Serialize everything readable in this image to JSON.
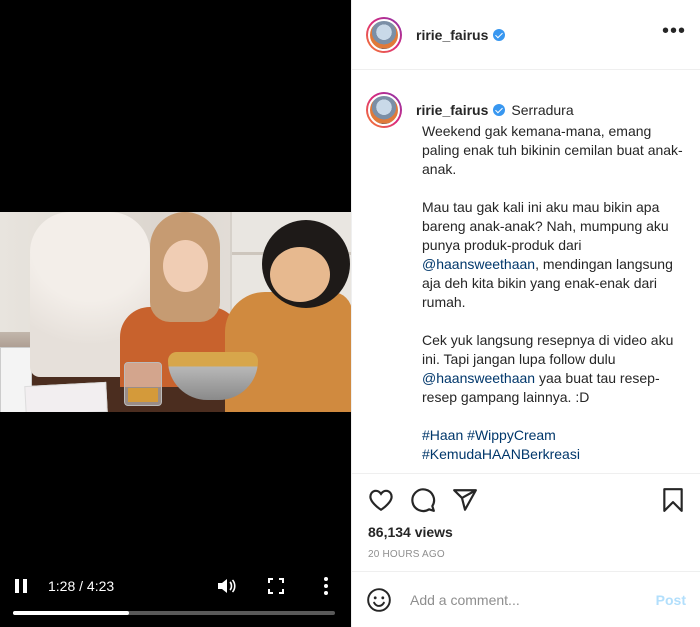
{
  "video": {
    "time_display": "1:28 / 4:23",
    "progress": 0.36,
    "icons": {
      "play": "pause-icon",
      "volume": "volume-icon",
      "fullscreen": "fullscreen-icon",
      "more": "more-vertical-icon"
    }
  },
  "header": {
    "username": "ririe_fairus",
    "more_label": "•••"
  },
  "caption": {
    "username": "ririe_fairus",
    "location": "Serradura",
    "p1": "Weekend gak kemana-mana, emang paling enak tuh bikinin cemilan buat anak-anak.",
    "p2_a": "Mau tau gak kali ini aku mau bikin apa bareng anak-anak? Nah, mumpung aku punya produk-produk dari ",
    "p2_mention": "@haansweethaan",
    "p2_b": ", mendingan langsung aja deh kita bikin yang enak-enak dari rumah.",
    "p3_a": "Cek yuk langsung resepnya di video aku ini. Tapi jangan lupa follow dulu ",
    "p3_mention": "@haansweethaan",
    "p3_b": " yaa buat tau resep-resep gampang lainnya. :D",
    "tag1": "#Haan",
    "tag2": "#WippyCream",
    "tag3": "#KemudaHAANBerkreasi"
  },
  "stats": {
    "views": "86,134 views",
    "time_ago": "20 HOURS AGO"
  },
  "comment": {
    "placeholder": "Add a comment...",
    "post_label": "Post"
  },
  "colors": {
    "link": "#00376b",
    "verified": "#3897f0",
    "post_disabled": "#b2dffc"
  }
}
